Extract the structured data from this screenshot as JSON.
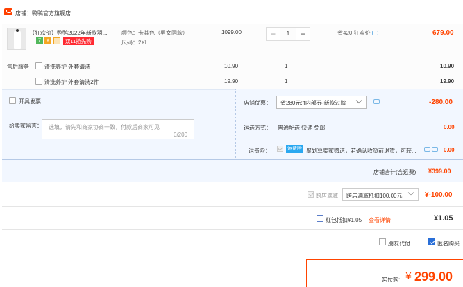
{
  "shop": {
    "label": "店铺：鸭鸭官方旗舰店"
  },
  "item": {
    "title": "【狂欢价】鸭鸭2022年新款羽...",
    "badges": [
      "7",
      "¥",
      "双11抢先购"
    ],
    "sku_color": "颜色：卡其色（男女同款）",
    "sku_size": "尺码：2XL",
    "price": "1099.00",
    "quantity": "1",
    "save_text": "省420:狂欢价",
    "total": "679.00"
  },
  "services": {
    "label": "售后服务",
    "rows": [
      {
        "name": "清洗养护 外套清洗",
        "price": "10.90",
        "qty": "1",
        "total": "10.90"
      },
      {
        "name": "清洗养护 外套清洗2件",
        "price": "19.90",
        "qty": "1",
        "total": "19.90"
      }
    ]
  },
  "invoice": {
    "label": "开具发票"
  },
  "message": {
    "label": "给卖家留言：",
    "placeholder": "选填，请先和商家协商一致，付款后商家可见",
    "count": "0/200"
  },
  "coupon": {
    "label": "店铺优惠：",
    "selected": "省280元:ff内部券-新款过膝",
    "amount": "-280.00"
  },
  "shipping": {
    "label": "运送方式：",
    "value": "普通配送 快递 免邮",
    "amount": "0.00"
  },
  "insurance": {
    "label": "运费险：",
    "badge": "运费险",
    "text": "聚划算卖家赠送，若确认收货前退货，可获...",
    "amount": "0.00"
  },
  "shop_total": {
    "label": "店铺合计(含运费)",
    "value": "¥399.00"
  },
  "discount": {
    "label": "跨店满减",
    "selected": "跨店满减抵扣100.00元",
    "amount": "¥-100.00"
  },
  "hongbao": {
    "label": "红包抵扣¥1.05",
    "link": "查看详情",
    "amount": "¥1.05"
  },
  "options": {
    "friend_pay": "朋友代付",
    "anonymous": "匿名购买"
  },
  "payment": {
    "label": "实付款:",
    "currency": "¥",
    "amount": "299.00"
  },
  "colors": {
    "accent": "#ff4400",
    "blue_bg": "#f2f7ff",
    "badge_red": "#ff2a32",
    "badge_blue": "#2aa8f0"
  }
}
